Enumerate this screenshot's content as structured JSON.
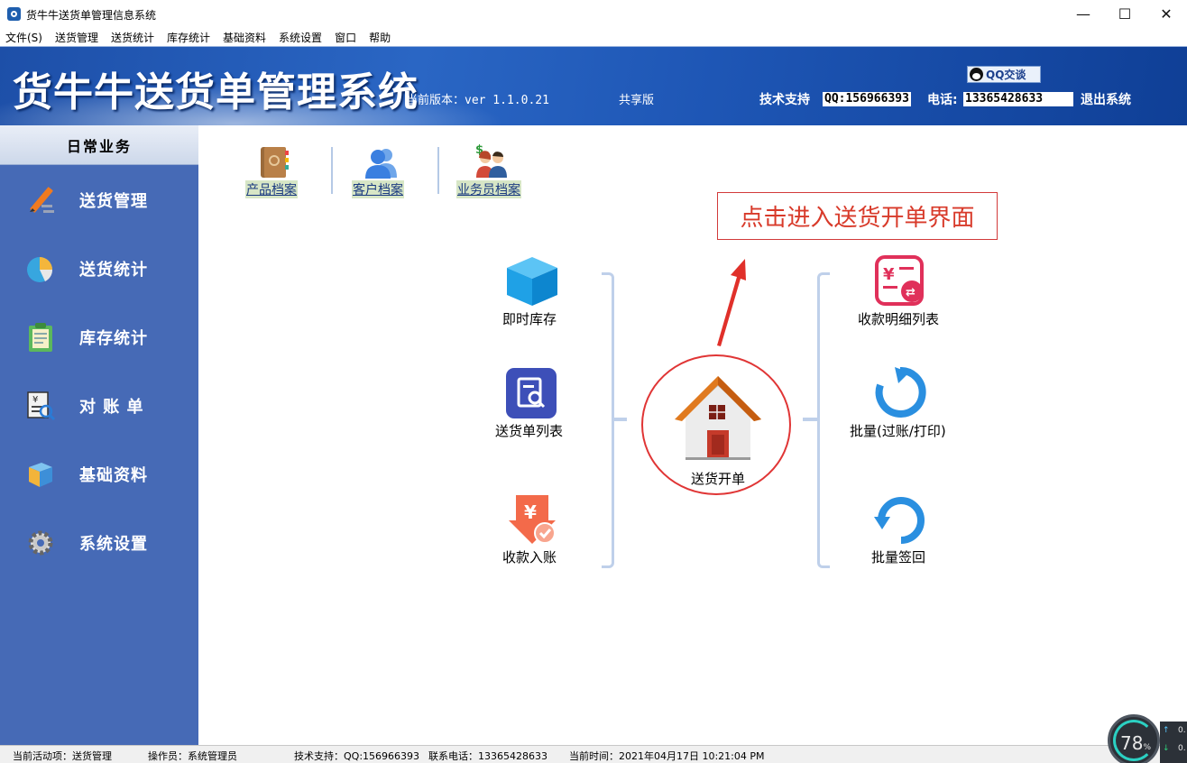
{
  "window": {
    "title": "货牛牛送货单管理信息系统",
    "controls": {
      "minimize": "—",
      "maximize": "☐",
      "close": "✕"
    }
  },
  "menu": [
    "文件(S)",
    "送货管理",
    "送货统计",
    "库存统计",
    "基础资料",
    "系统设置",
    "窗口",
    "帮助"
  ],
  "banner": {
    "title": "货牛牛送货单管理系统",
    "version": "当前版本：ver 1.1.0.21",
    "edition": "共享版",
    "support_label": "技术支持",
    "qq": "QQ:156966393",
    "phone_label": "电话:",
    "phone": "13365428633",
    "exit": "退出系统",
    "qq_chat": "QQ交谈"
  },
  "sidebar": {
    "header": "日常业务",
    "items": [
      {
        "label": "送货管理",
        "icon": "pencil-icon"
      },
      {
        "label": "送货统计",
        "icon": "pie-chart-icon"
      },
      {
        "label": "库存统计",
        "icon": "clipboard-icon"
      },
      {
        "label": "对 账 单",
        "icon": "invoice-search-icon"
      },
      {
        "label": "基础资料",
        "icon": "box-icon"
      },
      {
        "label": "系统设置",
        "icon": "gear-icon"
      }
    ]
  },
  "quick_links": [
    {
      "label": "产品档案",
      "icon": "book-icon"
    },
    {
      "label": "客户档案",
      "icon": "users-icon"
    },
    {
      "label": "业务员档案",
      "icon": "salesperson-icon"
    }
  ],
  "annotation": "点击进入送货开单界面",
  "functions": {
    "left": [
      {
        "label": "即时库存",
        "icon": "cube-icon"
      },
      {
        "label": "送货单列表",
        "icon": "document-search-icon"
      },
      {
        "label": "收款入账",
        "icon": "yuan-receipt-icon"
      }
    ],
    "center": {
      "label": "送货开单",
      "icon": "house-icon"
    },
    "right": [
      {
        "label": "收款明细列表",
        "icon": "payment-list-icon"
      },
      {
        "label": "批量(过账/打印)",
        "icon": "refresh-icon"
      },
      {
        "label": "批量签回",
        "icon": "return-icon"
      }
    ]
  },
  "status": {
    "activity": "当前活动项：送货管理",
    "operator": "操作员：系统管理员",
    "support": "技术支持：QQ:156966393",
    "phone": "联系电话：13365428633",
    "time": "当前时间：2021年04月17日 10:21:04 PM"
  },
  "widget": {
    "value": "78",
    "unit": "%",
    "up": "↑",
    "down": "↓",
    "up_val": "0.",
    "down_val": "0."
  }
}
